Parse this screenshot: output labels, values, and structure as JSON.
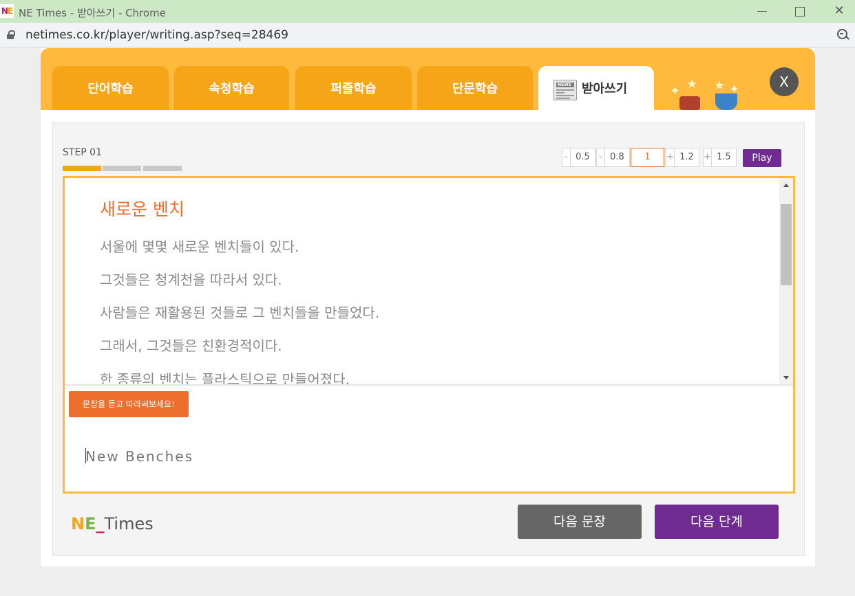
{
  "window": {
    "title": "NE Times - 받아쓰기 - Chrome",
    "url": "netimes.co.kr/player/writing.asp?seq=28469"
  },
  "tabs": [
    {
      "label": "단어학습"
    },
    {
      "label": "속청학습"
    },
    {
      "label": "퍼즐학습"
    },
    {
      "label": "단문학습"
    },
    {
      "label": "받아쓰기",
      "active": true
    }
  ],
  "close_label": "X",
  "step": {
    "label": "STEP 01",
    "progress": [
      1,
      0,
      0
    ]
  },
  "speed": {
    "options": [
      "0.5",
      "0.8",
      "1",
      "1.2",
      "1.5"
    ],
    "minus": "-",
    "plus": "+",
    "selected": "1",
    "play_label": "Play"
  },
  "reading": {
    "title": "새로운 벤치",
    "lines": [
      "서울에 몇몇 새로운 벤치들이 있다.",
      "그것들은 청계천을 따라서 있다.",
      "사람들은 재활용된 것들로 그 벤치들을 만들었다.",
      "그래서, 그것들은 친환경적이다.",
      "한 종류의 벤치는 플라스틱으로 만들어졌다."
    ]
  },
  "hint_label": "문장을 듣고 따라써보세요!",
  "answer": {
    "placeholder": "New Benches"
  },
  "footer": {
    "logo": {
      "n": "N",
      "e": "E",
      "underscore": "_",
      "times": "Times"
    },
    "next_sentence": "다음 문장",
    "next_step": "다음 단계"
  },
  "colors": {
    "accent": "#ffba3d",
    "tab": "#f6a519",
    "orange": "#ee6f2d",
    "purple": "#6f2b92"
  }
}
